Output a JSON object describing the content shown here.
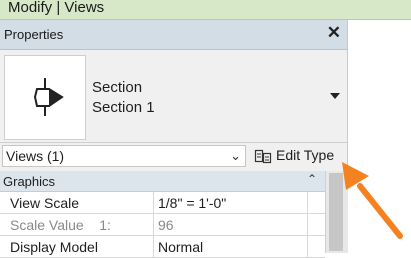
{
  "ribbon": {
    "title": "Modify | Views"
  },
  "properties": {
    "title": "Properties",
    "close_glyph": "✕",
    "type_selector": {
      "line1": "Section",
      "line2": "Section 1",
      "icon": "section-view-icon"
    },
    "instance_filter": {
      "value": "Views (1)"
    },
    "edit_type_label": "Edit Type",
    "groups": [
      {
        "label": "Graphics",
        "rows": [
          {
            "name": "View Scale",
            "value": "1/8\" = 1'-0\"",
            "greyed": false
          },
          {
            "name": "Scale Value    1:",
            "value": "96",
            "greyed": true
          },
          {
            "name": "Display Model",
            "value": "Normal",
            "greyed": false
          }
        ]
      }
    ]
  },
  "colors": {
    "ribbon_bg": "#d6e8c8",
    "header_bg": "#d3dde6",
    "annotation_arrow": "#f58220"
  }
}
